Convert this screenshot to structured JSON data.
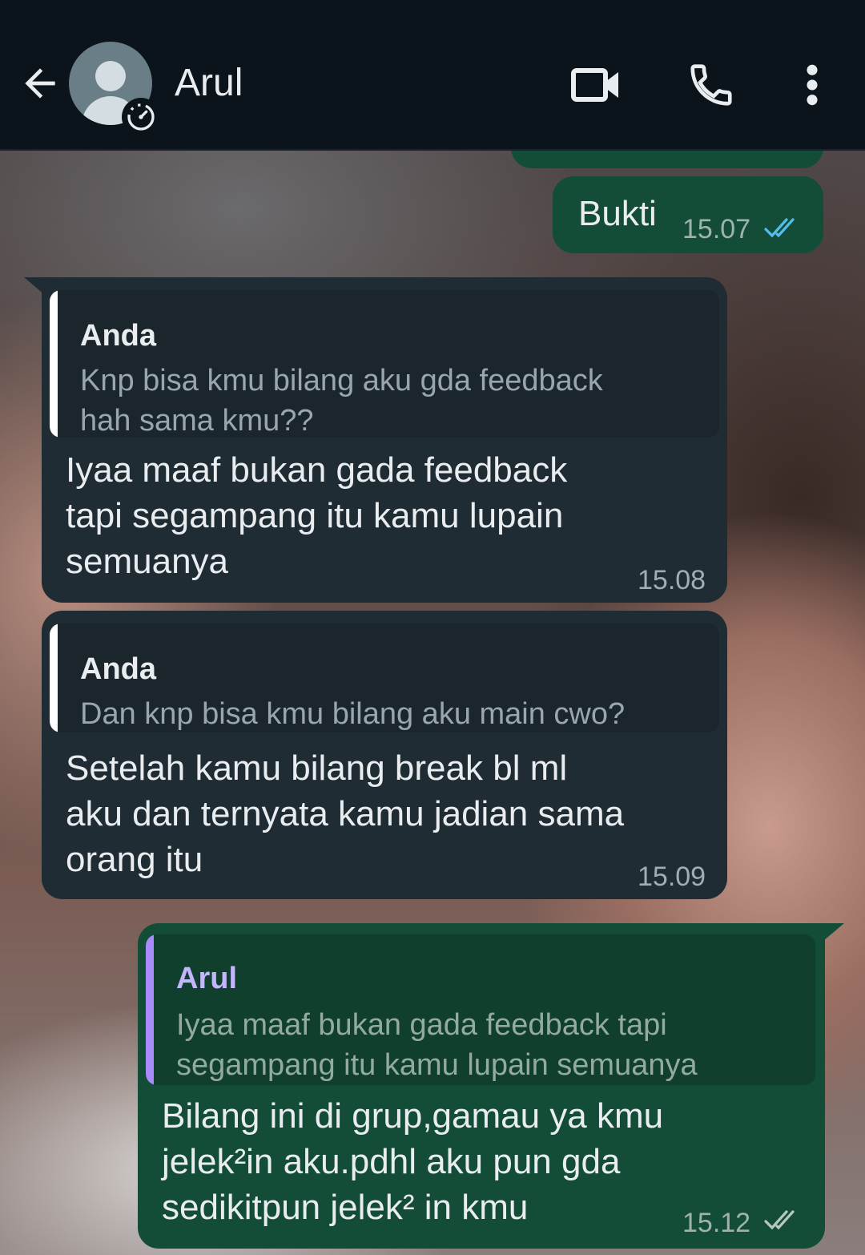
{
  "header": {
    "contact_name": "Arul",
    "back_icon": "arrow-left-icon",
    "video_icon": "video-camera-icon",
    "call_icon": "phone-icon",
    "menu_icon": "more-vertical-icon"
  },
  "colors": {
    "header_bg": "#0b141a",
    "outgoing_bubble": "#144d37",
    "incoming_bubble": "#1f2c33",
    "read_tick": "#53bdeb",
    "quote_bar_in": "#ffffff",
    "quote_bar_out": "#a78bfa"
  },
  "messages": [
    {
      "direction": "out",
      "text": "Bukti",
      "time": "15.07",
      "status": "read"
    },
    {
      "direction": "in",
      "quote_author": "Anda",
      "quote_text": "Knp bisa kmu bilang aku gda feedback\nhah sama kmu??",
      "text": "Iyaa maaf bukan gada feedback\ntapi segampang itu kamu lupain\nsemuanya",
      "time": "15.08"
    },
    {
      "direction": "in",
      "quote_author": "Anda",
      "quote_text": "Dan knp bisa kmu bilang aku main cwo?",
      "text": "Setelah kamu bilang break bl ml\naku dan ternyata kamu jadian sama\norang itu",
      "time": "15.09"
    },
    {
      "direction": "out",
      "quote_author": "Arul",
      "quote_text": "Iyaa maaf bukan gada feedback tapi\nsegampang itu kamu lupain semuanya",
      "text": "Bilang ini di grup,gamau ya kmu\njelek²in aku.pdhl aku pun gda\nsedikitpun jelek² in kmu",
      "time": "15.12",
      "status": "delivered"
    }
  ]
}
